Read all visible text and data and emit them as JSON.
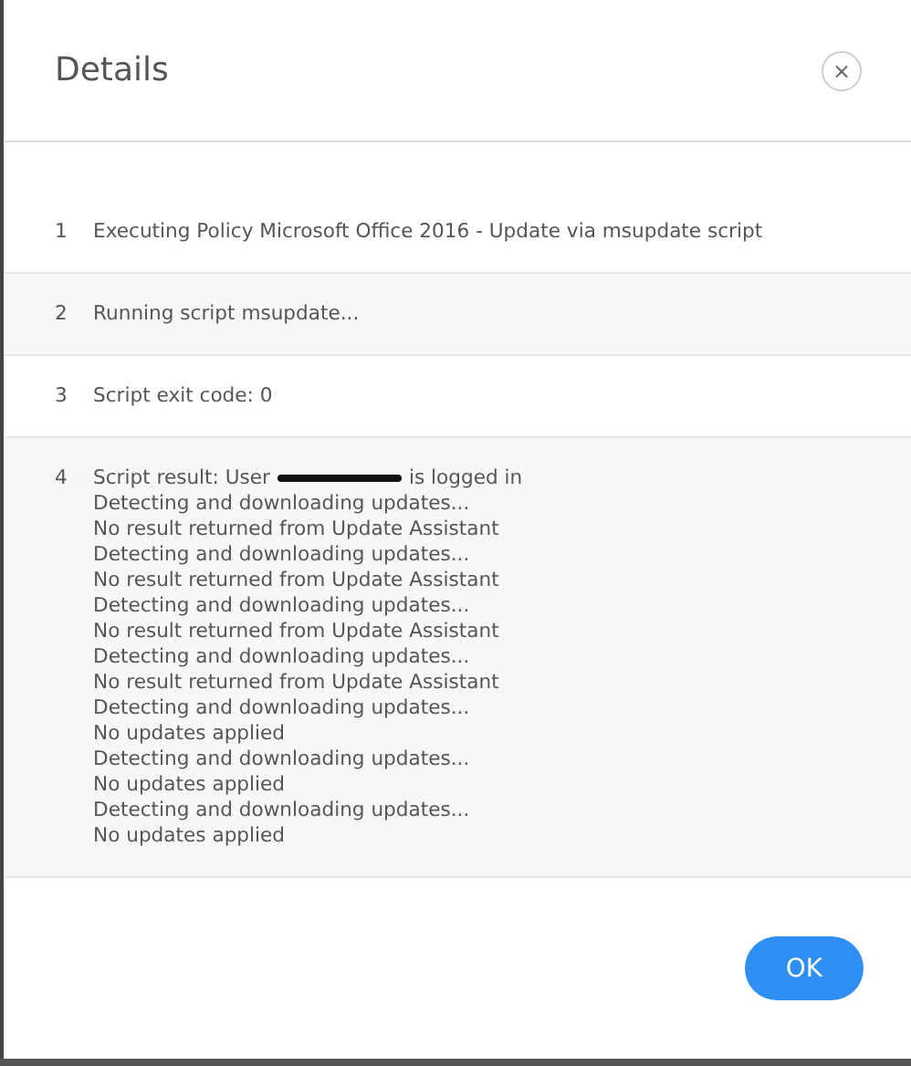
{
  "dialog": {
    "title": "Details",
    "close_glyph": "×"
  },
  "rows": [
    {
      "number": "1",
      "lines": [
        {
          "text": "Executing Policy Microsoft Office 2016 - Update via msupdate script"
        }
      ]
    },
    {
      "number": "2",
      "lines": [
        {
          "text": "Running script msupdate..."
        }
      ]
    },
    {
      "number": "3",
      "lines": [
        {
          "text": "Script exit code: 0"
        }
      ]
    },
    {
      "number": "4",
      "lines": [
        {
          "text": "Script result: User",
          "redacted": true,
          "after": "is logged in"
        },
        {
          "text": "Detecting and downloading updates..."
        },
        {
          "text": "No result returned from Update Assistant"
        },
        {
          "text": "Detecting and downloading updates..."
        },
        {
          "text": "No result returned from Update Assistant"
        },
        {
          "text": "Detecting and downloading updates..."
        },
        {
          "text": "No result returned from Update Assistant"
        },
        {
          "text": "Detecting and downloading updates..."
        },
        {
          "text": "No result returned from Update Assistant"
        },
        {
          "text": "Detecting and downloading updates..."
        },
        {
          "text": "No updates applied"
        },
        {
          "text": "Detecting and downloading updates..."
        },
        {
          "text": "No updates applied"
        },
        {
          "text": "Detecting and downloading updates..."
        },
        {
          "text": "No updates applied"
        }
      ]
    }
  ],
  "buttons": [
    {
      "label": "OK"
    }
  ]
}
